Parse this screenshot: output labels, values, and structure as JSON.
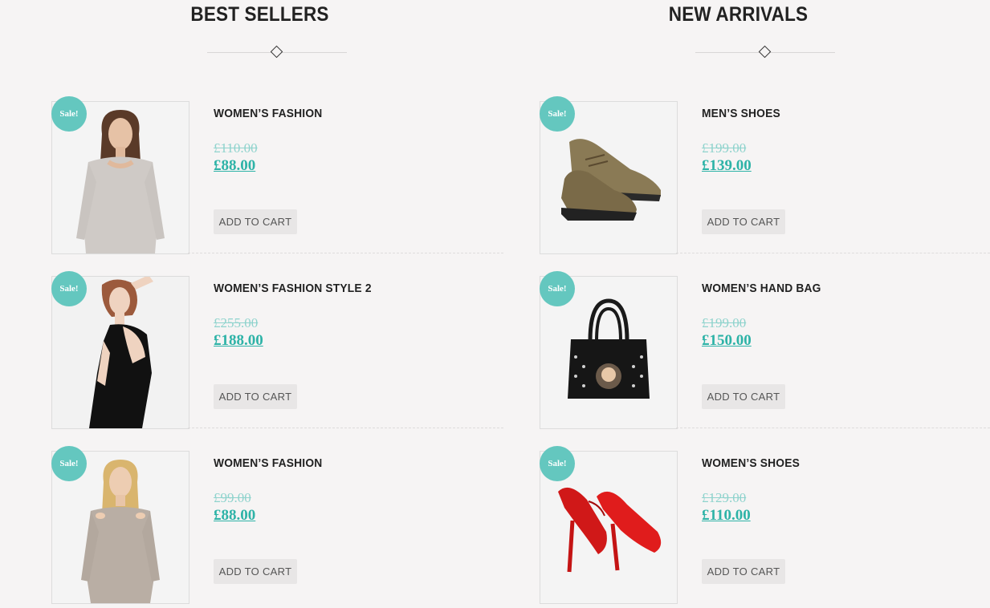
{
  "best_sellers": {
    "title": "BEST SELLERS",
    "products": [
      {
        "name": "WOMEN’S FASHION",
        "badge": "Sale!",
        "old_price": "£110.00",
        "new_price": "£88.00",
        "button": "ADD TO CART"
      },
      {
        "name": "WOMEN’S FASHION STYLE 2",
        "badge": "Sale!",
        "old_price": "£255.00",
        "new_price": "£188.00",
        "button": "ADD TO CART"
      },
      {
        "name": "WOMEN’S FASHION",
        "badge": "Sale!",
        "old_price": "£99.00",
        "new_price": "£88.00",
        "button": "ADD TO CART"
      }
    ]
  },
  "new_arrivals": {
    "title": "NEW ARRIVALS",
    "products": [
      {
        "name": "MEN’S SHOES",
        "badge": "Sale!",
        "old_price": "£199.00",
        "new_price": "£139.00",
        "button": "ADD TO CART"
      },
      {
        "name": "WOMEN’S HAND BAG",
        "badge": "Sale!",
        "old_price": "£199.00",
        "new_price": "£150.00",
        "button": "ADD TO CART"
      },
      {
        "name": "WOMEN’S SHOES",
        "badge": "Sale!",
        "old_price": "£129.00",
        "new_price": "£110.00",
        "button": "ADD TO CART"
      }
    ]
  },
  "colors": {
    "accent": "#2eb3a7",
    "sale_badge": "#64c7bf",
    "old_price": "#8fd3cd",
    "background": "#f6f4f4"
  }
}
